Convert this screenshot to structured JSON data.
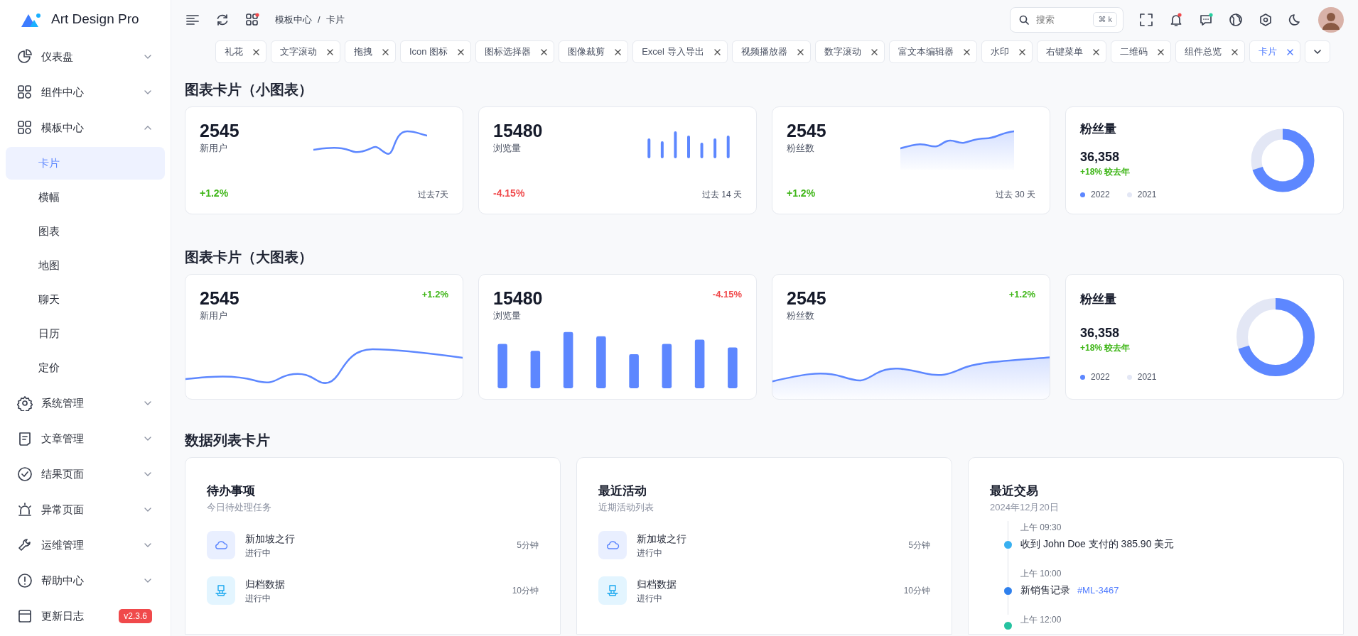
{
  "sidebar": {
    "logo": "Art Design Pro",
    "items": [
      {
        "label": "仪表盘",
        "expanded": false
      },
      {
        "label": "组件中心",
        "expanded": false
      },
      {
        "label": "模板中心",
        "expanded": true,
        "children": [
          {
            "label": "卡片",
            "selected": true
          },
          {
            "label": "横幅",
            "selected": false
          },
          {
            "label": "图表",
            "selected": false
          },
          {
            "label": "地图",
            "selected": false
          },
          {
            "label": "聊天",
            "selected": false
          },
          {
            "label": "日历",
            "selected": false
          },
          {
            "label": "定价",
            "selected": false
          }
        ]
      },
      {
        "label": "系统管理",
        "expanded": false
      },
      {
        "label": "文章管理",
        "expanded": false
      },
      {
        "label": "结果页面",
        "expanded": false
      },
      {
        "label": "异常页面",
        "expanded": false
      },
      {
        "label": "运维管理",
        "expanded": false
      },
      {
        "label": "帮助中心",
        "expanded": false
      },
      {
        "label": "更新日志",
        "badge": "v2.3.6"
      }
    ]
  },
  "header": {
    "breadcrumb": [
      "模板中心",
      "卡片"
    ],
    "breadcrumb_separator": "/",
    "search": {
      "placeholder": "搜索",
      "shortcut": "⌘ k"
    }
  },
  "tabs": [
    {
      "label": "礼花",
      "selected": false
    },
    {
      "label": "文字滚动",
      "selected": false
    },
    {
      "label": "拖拽",
      "selected": false
    },
    {
      "label": "Icon 图标",
      "selected": false
    },
    {
      "label": "图标选择器",
      "selected": false
    },
    {
      "label": "图像裁剪",
      "selected": false
    },
    {
      "label": "Excel 导入导出",
      "selected": false
    },
    {
      "label": "视频播放器",
      "selected": false
    },
    {
      "label": "数字滚动",
      "selected": false
    },
    {
      "label": "富文本编辑器",
      "selected": false
    },
    {
      "label": "水印",
      "selected": false
    },
    {
      "label": "右键菜单",
      "selected": false
    },
    {
      "label": "二维码",
      "selected": false
    },
    {
      "label": "组件总览",
      "selected": false
    },
    {
      "label": "卡片",
      "selected": true
    }
  ],
  "small_charts": {
    "title": "图表卡片（小图表）",
    "cards": [
      {
        "kind": "line",
        "value": "2545",
        "label": "新用户",
        "change": "+1.2%",
        "negative": false,
        "period": "过去7天"
      },
      {
        "kind": "bar",
        "value": "15480",
        "label": "浏览量",
        "change": "-4.15%",
        "negative": true,
        "period": "过去 14 天"
      },
      {
        "kind": "area",
        "value": "2545",
        "label": "粉丝数",
        "change": "+1.2%",
        "negative": false,
        "period": "过去 30 天"
      },
      {
        "kind": "donut",
        "title": "粉丝量",
        "value": "36,358",
        "change": "+18% 较去年",
        "negative": false,
        "legend": [
          {
            "label": "2022",
            "color": "#5d87ff"
          },
          {
            "label": "2021",
            "color": "#e3e7f5"
          }
        ]
      }
    ]
  },
  "large_charts": {
    "title": "图表卡片（大图表）",
    "cards": [
      {
        "kind": "line",
        "value": "2545",
        "label": "新用户",
        "change": "+1.2%",
        "negative": false
      },
      {
        "kind": "bar",
        "value": "15480",
        "label": "浏览量",
        "change": "-4.15%",
        "negative": true
      },
      {
        "kind": "area",
        "value": "2545",
        "label": "粉丝数",
        "change": "+1.2%",
        "negative": false
      },
      {
        "kind": "donut",
        "title": "粉丝量",
        "value": "36,358",
        "change": "+18% 较去年",
        "negative": false,
        "legend": [
          {
            "label": "2022",
            "color": "#5d87ff"
          },
          {
            "label": "2021",
            "color": "#e3e7f5"
          }
        ]
      }
    ]
  },
  "list_section": {
    "title": "数据列表卡片",
    "cards": [
      {
        "kind": "tasks",
        "title": "待办事项",
        "subtitle": "今日待处理任务",
        "items": [
          {
            "title": "新加坡之行",
            "status": "进行中",
            "time": "5分钟"
          },
          {
            "title": "归档数据",
            "status": "进行中",
            "time": "10分钟"
          }
        ]
      },
      {
        "kind": "tasks",
        "title": "最近活动",
        "subtitle": "近期活动列表",
        "items": [
          {
            "title": "新加坡之行",
            "status": "进行中",
            "time": "5分钟"
          },
          {
            "title": "归档数据",
            "status": "进行中",
            "time": "10分钟"
          }
        ]
      },
      {
        "kind": "timeline",
        "title": "最近交易",
        "subtitle": "2024年12月20日",
        "items": [
          {
            "time": "上午 09:30",
            "text": "收到 John Doe 支付的 385.90 美元",
            "color": "#38b0f0"
          },
          {
            "time": "上午 10:00",
            "text": "新销售记录",
            "link": "#ML-3467",
            "color": "#2f80ed"
          },
          {
            "time": "上午 12:00",
            "color": "#25c2a0"
          }
        ]
      }
    ]
  }
}
